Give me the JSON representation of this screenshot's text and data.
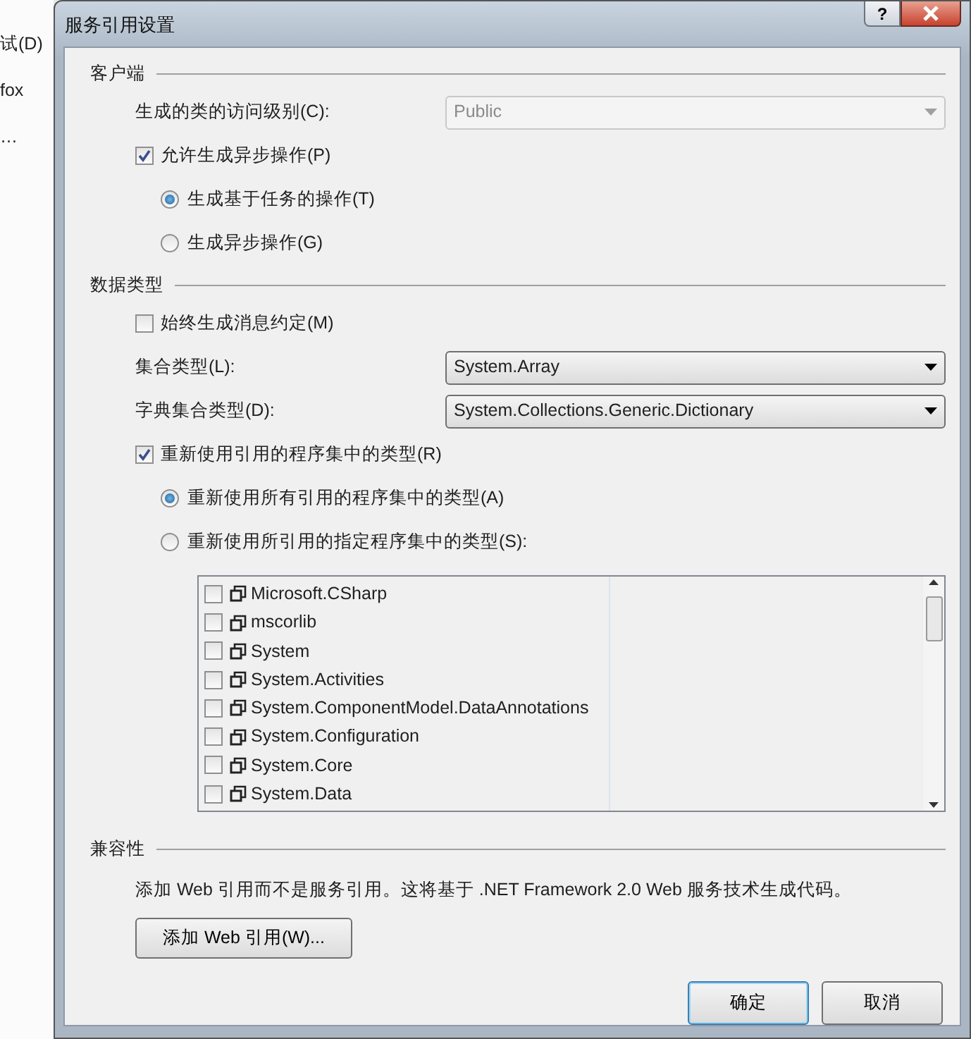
{
  "background": {
    "texts": [
      "试(D)",
      "fox",
      "…"
    ]
  },
  "window": {
    "title": "服务引用设置",
    "help": "?"
  },
  "client": {
    "heading": "客户端",
    "access_level": {
      "label": "生成的类的访问级别(C):",
      "value": "Public",
      "disabled": true
    },
    "async": {
      "label": "允许生成异步操作(P)",
      "checked": true,
      "options": [
        {
          "label": "生成基于任务的操作(T)",
          "selected": true
        },
        {
          "label": "生成异步操作(G)",
          "selected": false
        }
      ]
    }
  },
  "data_types": {
    "heading": "数据类型",
    "always_message": {
      "label": "始终生成消息约定(M)",
      "checked": false
    },
    "collection": {
      "label": "集合类型(L):",
      "value": "System.Array",
      "disabled": false
    },
    "dictionary": {
      "label": "字典集合类型(D):",
      "value": "System.Collections.Generic.Dictionary",
      "disabled": false
    },
    "reuse": {
      "label": "重新使用引用的程序集中的类型(R)",
      "checked": true,
      "options": [
        {
          "label": "重新使用所有引用的程序集中的类型(A)",
          "selected": true
        },
        {
          "label": "重新使用所引用的指定程序集中的类型(S):",
          "selected": false
        }
      ]
    },
    "assemblies": [
      {
        "name": "Microsoft.CSharp",
        "checked": false
      },
      {
        "name": "mscorlib",
        "checked": false
      },
      {
        "name": "System",
        "checked": false
      },
      {
        "name": "System.Activities",
        "checked": false
      },
      {
        "name": "System.ComponentModel.DataAnnotations",
        "checked": false
      },
      {
        "name": "System.Configuration",
        "checked": false
      },
      {
        "name": "System.Core",
        "checked": false
      },
      {
        "name": "System.Data",
        "checked": false
      }
    ]
  },
  "compatibility": {
    "heading": "兼容性",
    "description": "添加 Web 引用而不是服务引用。这将基于 .NET Framework 2.0 Web 服务技术生成代码。",
    "button": "添加 Web 引用(W)..."
  },
  "buttons": [
    {
      "label": "确定",
      "default": true
    },
    {
      "label": "取消",
      "default": false
    }
  ]
}
